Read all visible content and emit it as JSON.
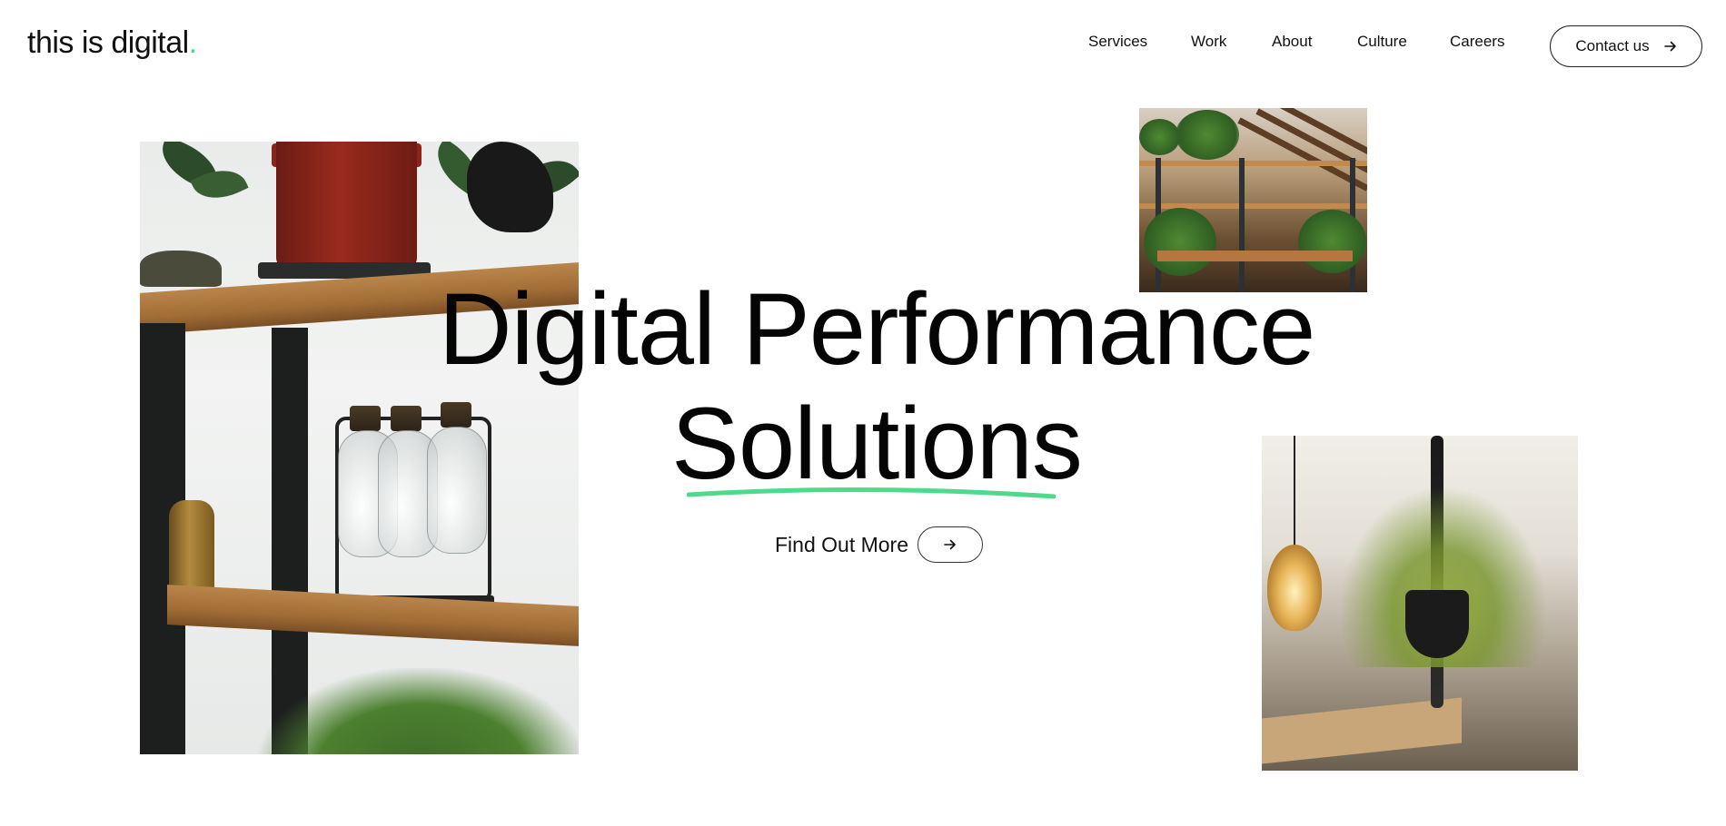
{
  "header": {
    "logo_text": "this is digital",
    "logo_dot": ".",
    "nav": [
      {
        "label": "Services"
      },
      {
        "label": "Work"
      },
      {
        "label": "About"
      },
      {
        "label": "Culture"
      },
      {
        "label": "Careers"
      }
    ],
    "contact_label": "Contact us"
  },
  "hero": {
    "title_line1": "Digital Performance",
    "title_line2": "Solutions",
    "cta_label": "Find Out More"
  },
  "colors": {
    "accent": "#4fd98c",
    "text": "#0a0a0a",
    "background": "#ffffff"
  },
  "icons": {
    "cta_arrow": "arrow-right-icon",
    "contact_arrow": "arrow-right-icon"
  },
  "images": [
    {
      "name": "shelf-photo",
      "alt": ""
    },
    {
      "name": "office-photo",
      "alt": ""
    },
    {
      "name": "hanging-plant-photo",
      "alt": ""
    }
  ]
}
